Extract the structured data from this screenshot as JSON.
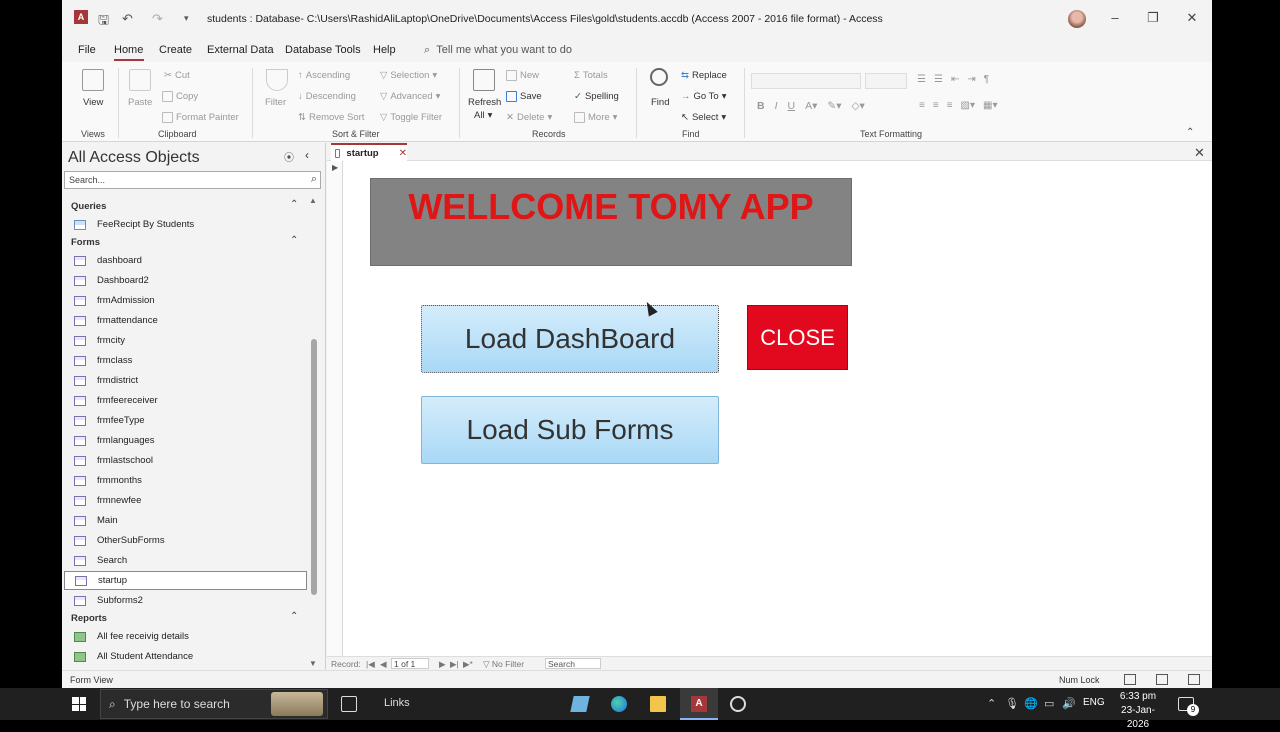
{
  "window": {
    "title": "students : Database- C:\\Users\\RashidAliLaptop\\OneDrive\\Documents\\Access Files\\gold\\students.accdb (Access 2007 - 2016 file format)  -  Access"
  },
  "menu": {
    "tabs": [
      "File",
      "Home",
      "Create",
      "External Data",
      "Database Tools",
      "Help"
    ],
    "tell_me": "Tell me what you want to do"
  },
  "ribbon": {
    "views": {
      "view_label": "View",
      "group": "Views"
    },
    "clipboard": {
      "paste": "Paste",
      "cut": "Cut",
      "copy": "Copy",
      "format_painter": "Format Painter",
      "group": "Clipboard"
    },
    "sort_filter": {
      "filter": "Filter",
      "ascending": "Ascending",
      "descending": "Descending",
      "remove_sort": "Remove Sort",
      "selection": "Selection",
      "advanced": "Advanced",
      "toggle_filter": "Toggle Filter",
      "group": "Sort & Filter"
    },
    "records": {
      "refresh": "Refresh",
      "refresh_all": "All",
      "new": "New",
      "save": "Save",
      "delete": "Delete",
      "totals": "Totals",
      "spelling": "Spelling",
      "more": "More",
      "group": "Records"
    },
    "find": {
      "find": "Find",
      "replace": "Replace",
      "goto": "Go To",
      "select": "Select",
      "group": "Find"
    },
    "text_formatting": {
      "group": "Text Formatting"
    }
  },
  "navpane": {
    "title": "All Access Objects",
    "search_placeholder": "Search...",
    "sections": {
      "queries": "Queries",
      "forms": "Forms",
      "reports": "Reports"
    },
    "queries": [
      "FeeRecipt By Students"
    ],
    "forms": [
      "dashboard",
      "Dashboard2",
      "frmAdmission",
      "frmattendance",
      "frmcity",
      "frmclass",
      "frmdistrict",
      "frmfeereceiver",
      "frmfeeType",
      "frmlanguages",
      "frmlastschool",
      "frmmonths",
      "frmnewfee",
      "Main",
      "OtherSubForms",
      "Search",
      "startup",
      "Subforms2"
    ],
    "reports": [
      "All fee receivig details",
      "All Student Attendance"
    ],
    "selected": "startup"
  },
  "document": {
    "tab_label": "startup",
    "banner_text": "WELLCOME TOMY APP",
    "buttons": {
      "load_dashboard": "Load DashBoard",
      "close": "CLOSE",
      "load_subforms": "Load Sub Forms"
    }
  },
  "record_nav": {
    "label": "Record:",
    "position": "1 of 1",
    "filter": "No Filter",
    "search": "Search"
  },
  "statusbar": {
    "left": "Form View",
    "numlock": "Num Lock"
  },
  "taskbar": {
    "search_placeholder": "Type here to search",
    "links": "Links",
    "language": "ENG",
    "time": "6:33 pm",
    "date": "23-Jan-2026",
    "notification_count": "9"
  },
  "colors": {
    "banner_bg": "#838383",
    "banner_text": "#e01515",
    "close_button": "#e2081e",
    "form_button": "#bfe3f9",
    "accent": "#a4373a"
  }
}
